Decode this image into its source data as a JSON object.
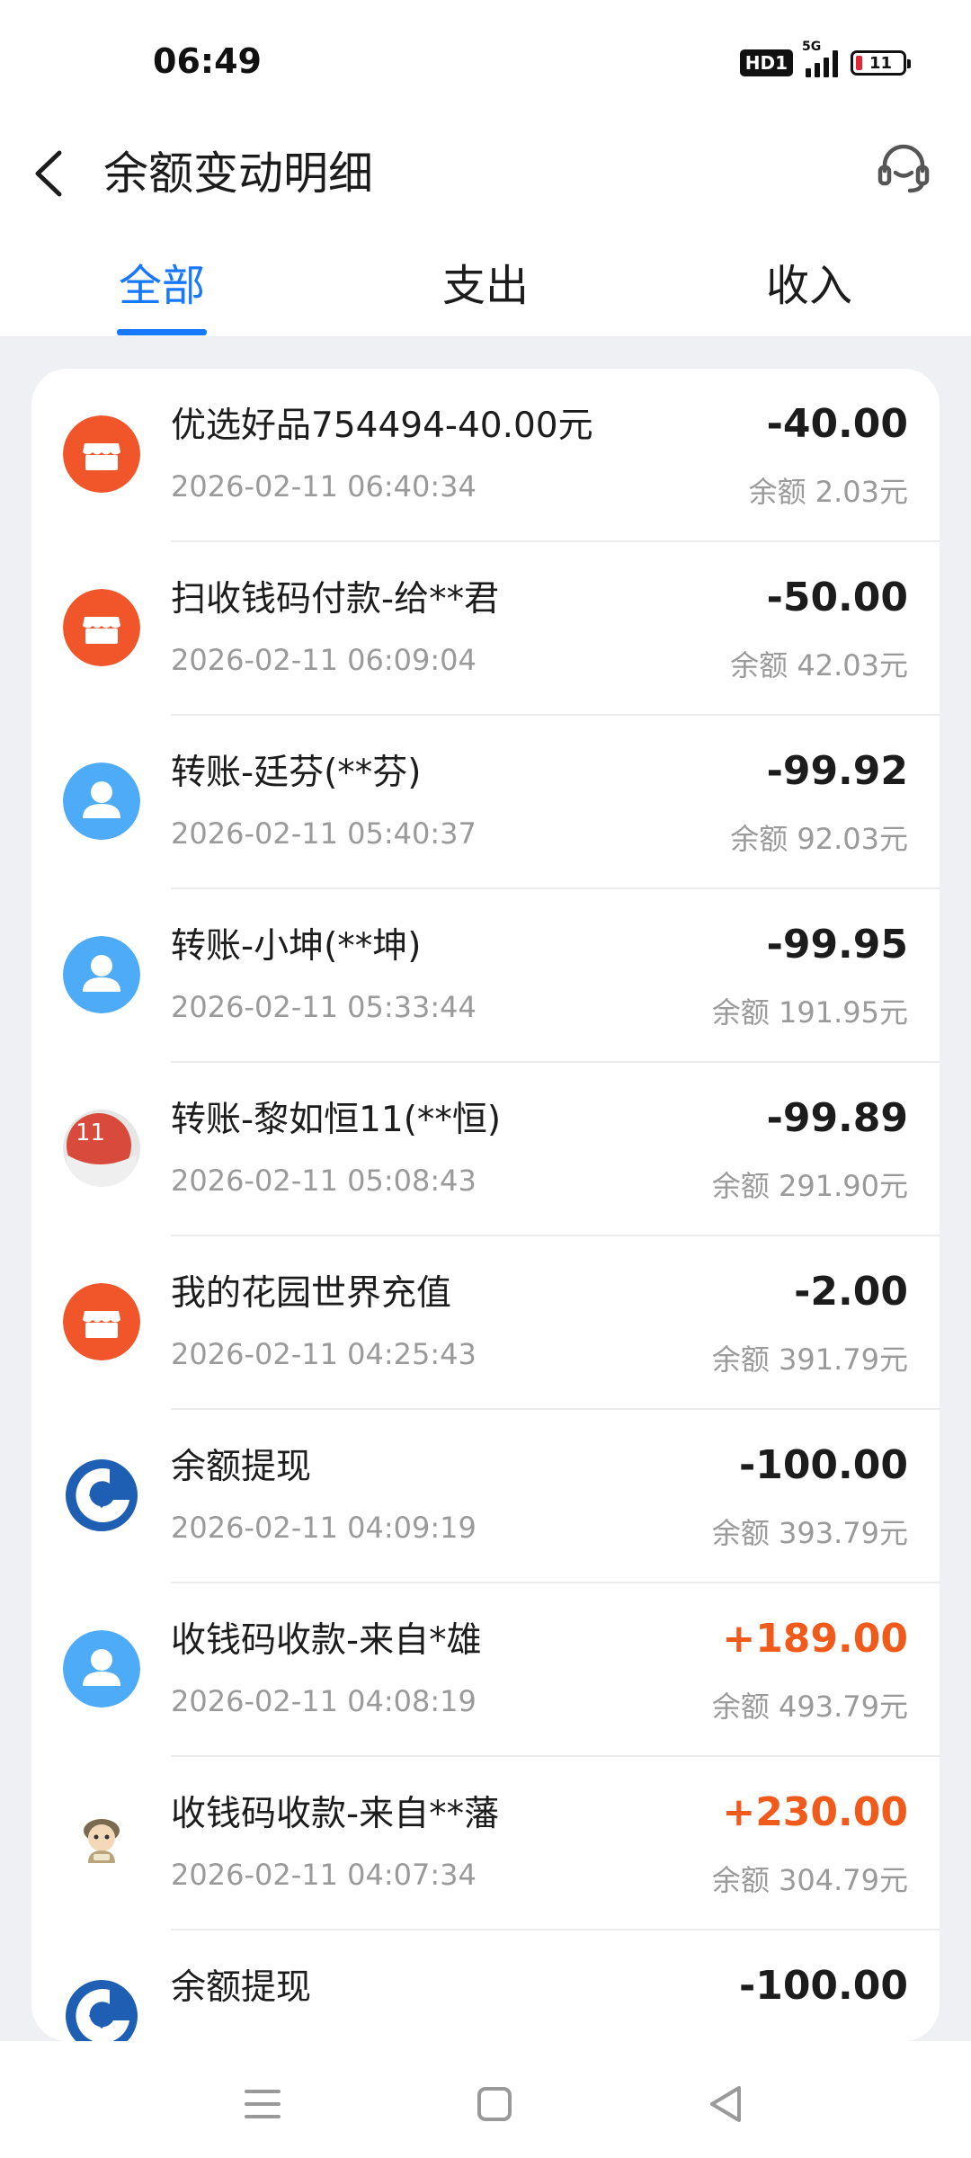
{
  "status_bar": {
    "time": "06:49",
    "hd": "HD1",
    "network": "5G",
    "battery": "11"
  },
  "header": {
    "title": "余额变动明细",
    "back_icon": "chevron-left-icon",
    "support_icon": "headset-icon"
  },
  "tabs": [
    {
      "label": "全部",
      "active": true
    },
    {
      "label": "支出",
      "active": false
    },
    {
      "label": "收入",
      "active": false
    }
  ],
  "colors": {
    "accent": "#1677ff",
    "income": "#f05a1a",
    "shop_icon": "#f0562a",
    "person_icon": "#4dabf7",
    "bank_icon": "#1e5fb4"
  },
  "transactions": [
    {
      "title": "优选好品754494-40.00元",
      "time": "2026-02-11 06:40:34",
      "amount": "-40.00",
      "balance": "余额 2.03元",
      "icon": "shop-icon"
    },
    {
      "title": "扫收钱码付款-给**君",
      "time": "2026-02-11 06:09:04",
      "amount": "-50.00",
      "balance": "余额 42.03元",
      "icon": "shop-icon"
    },
    {
      "title": "转账-廷芬(**芬)",
      "time": "2026-02-11 05:40:37",
      "amount": "-99.92",
      "balance": "余额 92.03元",
      "icon": "person-icon"
    },
    {
      "title": "转账-小坤(**坤)",
      "time": "2026-02-11 05:33:44",
      "amount": "-99.95",
      "balance": "余额 191.95元",
      "icon": "person-icon"
    },
    {
      "title": "转账-黎如恒11(**恒)",
      "time": "2026-02-11 05:08:43",
      "amount": "-99.89",
      "balance": "余额 291.90元",
      "icon": "photo-avatar",
      "avatar_text": "11"
    },
    {
      "title": "我的花园世界充值",
      "time": "2026-02-11 04:25:43",
      "amount": "-2.00",
      "balance": "余额 391.79元",
      "icon": "shop-icon"
    },
    {
      "title": "余额提现",
      "time": "2026-02-11 04:09:19",
      "amount": "-100.00",
      "balance": "余额 393.79元",
      "icon": "bank-icon"
    },
    {
      "title": "收钱码收款-来自*雄",
      "time": "2026-02-11 04:08:19",
      "amount": "+189.00",
      "balance": "余额 493.79元",
      "icon": "person-icon"
    },
    {
      "title": "收钱码收款-来自**藩",
      "time": "2026-02-11 04:07:34",
      "amount": "+230.00",
      "balance": "余额 304.79元",
      "icon": "cartoon-avatar"
    },
    {
      "title": "余额提现",
      "time": "",
      "amount": "-100.00",
      "balance": "",
      "icon": "bank-icon"
    }
  ],
  "nav": {
    "menu_icon": "menu-icon",
    "home_icon": "home-square-icon",
    "back_icon": "back-triangle-icon"
  }
}
